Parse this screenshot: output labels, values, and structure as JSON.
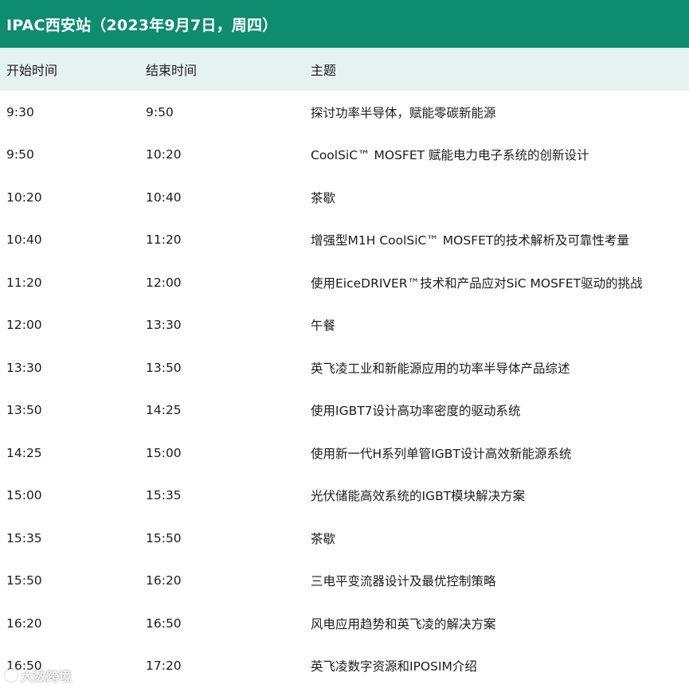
{
  "title": "IPAC西安站（2023年9月7日，周四）",
  "colors": {
    "title_bar": "#0e8c6f",
    "header_bg": "#e6f2f0",
    "text": "#1c1c1c"
  },
  "table": {
    "headers": {
      "start": "开始时间",
      "end": "结束时间",
      "topic": "主题"
    },
    "rows": [
      {
        "start": "9:30",
        "end": "9:50",
        "topic": "探讨功率半导体，赋能零碳新能源"
      },
      {
        "start": "9:50",
        "end": "10:20",
        "topic": "CoolSiC™ MOSFET 赋能电力电子系统的创新设计"
      },
      {
        "start": "10:20",
        "end": "10:40",
        "topic": "茶歇"
      },
      {
        "start": "10:40",
        "end": "11:20",
        "topic": "增强型M1H CoolSiC™ MOSFET的技术解析及可靠性考量"
      },
      {
        "start": "11:20",
        "end": "12:00",
        "topic": "使用EiceDRIVER™技术和产品应对SiC MOSFET驱动的挑战"
      },
      {
        "start": "12:00",
        "end": "13:30",
        "topic": "午餐"
      },
      {
        "start": "13:30",
        "end": "13:50",
        "topic": "英飞凌工业和新能源应用的功率半导体产品综述"
      },
      {
        "start": "13:50",
        "end": "14:25",
        "topic": "使用IGBT7设计高功率密度的驱动系统"
      },
      {
        "start": "14:25",
        "end": "15:00",
        "topic": "使用新一代H系列单管IGBT设计高效新能源系统"
      },
      {
        "start": "15:00",
        "end": "15:35",
        "topic": "光伏储能高效系统的IGBT模块解决方案"
      },
      {
        "start": "15:35",
        "end": "15:50",
        "topic": "茶歇"
      },
      {
        "start": "15:50",
        "end": "16:20",
        "topic": "三电平变流器设计及最优控制策略"
      },
      {
        "start": "16:20",
        "end": "16:50",
        "topic": "风电应用趋势和英飞凌的解决方案"
      },
      {
        "start": "16:50",
        "end": "17:20",
        "topic": "英飞凌数字资源和IPOSIM介绍"
      }
    ]
  },
  "watermark": {
    "text": "大数跨境",
    "icon": "logo-icon"
  }
}
